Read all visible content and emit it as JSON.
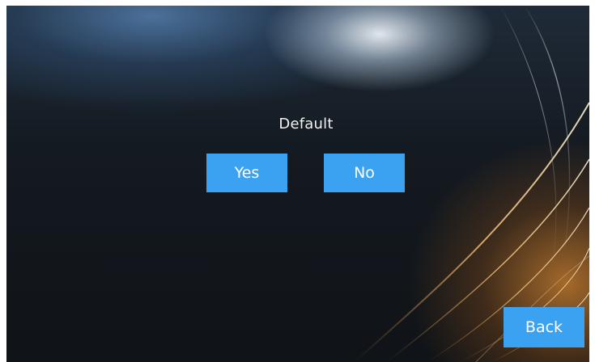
{
  "dialog": {
    "title": "Default",
    "yes_label": "Yes",
    "no_label": "No"
  },
  "navigation": {
    "back_label": "Back"
  },
  "colors": {
    "button_background": "#3aa2f0",
    "button_text": "#ffffff",
    "prompt_text": "#f2f2f2"
  }
}
